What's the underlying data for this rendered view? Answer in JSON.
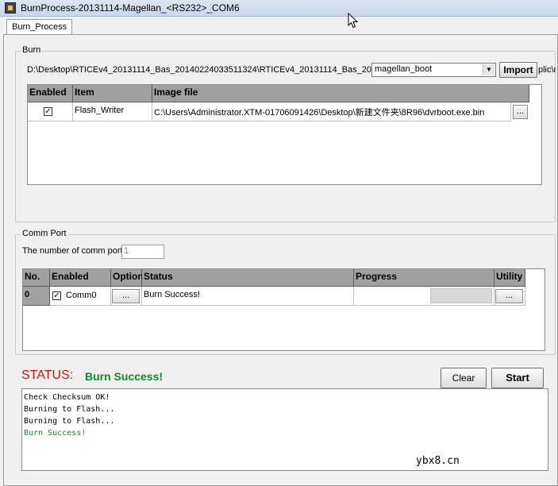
{
  "window": {
    "title": "BurnProcess-20131114-Magellan_<RS232>_COM6"
  },
  "tabs": [
    {
      "label": "Burn_Process"
    }
  ],
  "burn": {
    "group_title": "Burn",
    "path": "D:\\Desktop\\RTICEv4_20131114_Bas_20140224033511324\\RTICEv4_20131114_Bas_20",
    "path_overflow": "plic\\m",
    "profile": "magellan_boot",
    "import_label": "Import",
    "columns": [
      "Enabled",
      "Item",
      "Image file"
    ],
    "rows": [
      {
        "enabled": true,
        "item": "Flash_Writer",
        "image_file": "C:\\Users\\Administrator.XTM-01706091426\\Desktop\\新建文件夹\\8R96\\dvrboot.exe.bin",
        "browse_label": "..."
      }
    ]
  },
  "comm": {
    "group_title": "Comm Port",
    "count_label": "The number of comm port",
    "count_value": "1",
    "columns": [
      "No.",
      "Enabled",
      "Option",
      "Status",
      "Progress",
      "Utility"
    ],
    "rows": [
      {
        "no": "0",
        "enabled": true,
        "port": "Comm0",
        "option_label": "...",
        "status": "Burn Success!",
        "progress": 0,
        "utility_label": "..."
      }
    ]
  },
  "status": {
    "label": "STATUS:",
    "value": "Burn Success!",
    "clear_label": "Clear",
    "start_label": "Start",
    "log": [
      {
        "text": "Check Checksum OK!",
        "kind": "normal"
      },
      {
        "text": "Burning to Flash...",
        "kind": "normal"
      },
      {
        "text": "Burning to Flash...",
        "kind": "normal"
      },
      {
        "text": "Burn Success!",
        "kind": "success"
      }
    ]
  },
  "watermark": {
    "text": "ybx8.cn"
  },
  "colors": {
    "header_gray": "#a0a0a0",
    "status_red": "#cc1111",
    "status_green": "#14882b"
  }
}
